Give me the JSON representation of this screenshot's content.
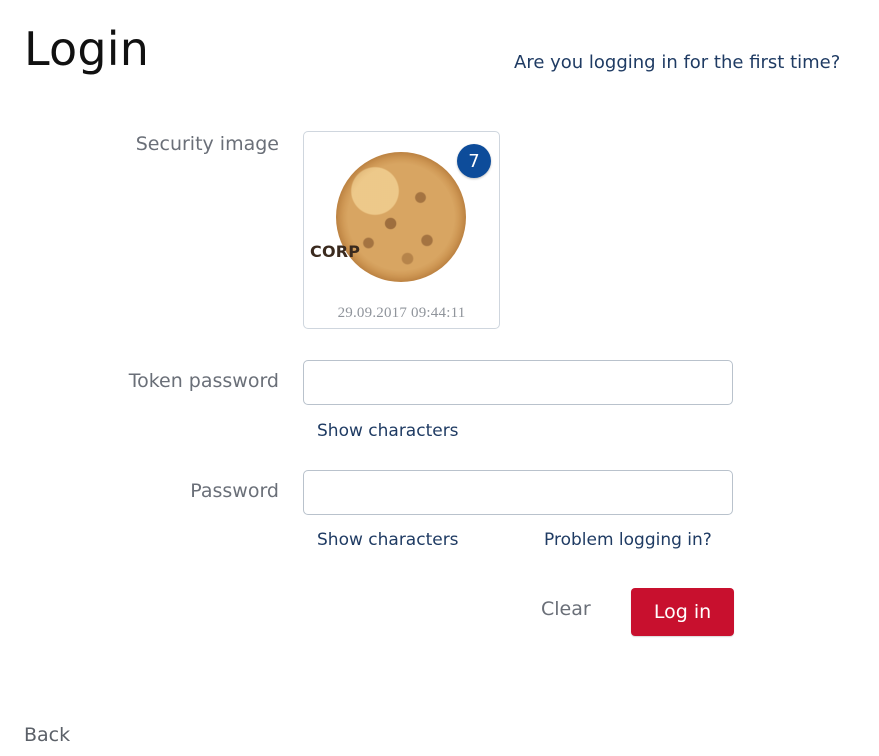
{
  "header": {
    "title": "Login",
    "first_time_link": "Are you logging in for the first time?"
  },
  "form": {
    "security_image": {
      "label": "Security image",
      "image_icon": "cookie-image",
      "overlay_text": "CORP",
      "badge_number": "7",
      "timestamp": "29.09.2017 09:44:11"
    },
    "token_password": {
      "label": "Token password",
      "value": "",
      "placeholder": "",
      "show_characters": "Show characters"
    },
    "password": {
      "label": "Password",
      "value": "",
      "placeholder": "",
      "show_characters": "Show characters",
      "problem_link": "Problem logging in?"
    },
    "actions": {
      "clear_label": "Clear",
      "login_label": "Log in"
    }
  },
  "footer": {
    "back_label": "Back"
  },
  "colors": {
    "primary_button": "#c8102e",
    "link": "#1f3b63",
    "badge": "#0d4c9a"
  }
}
